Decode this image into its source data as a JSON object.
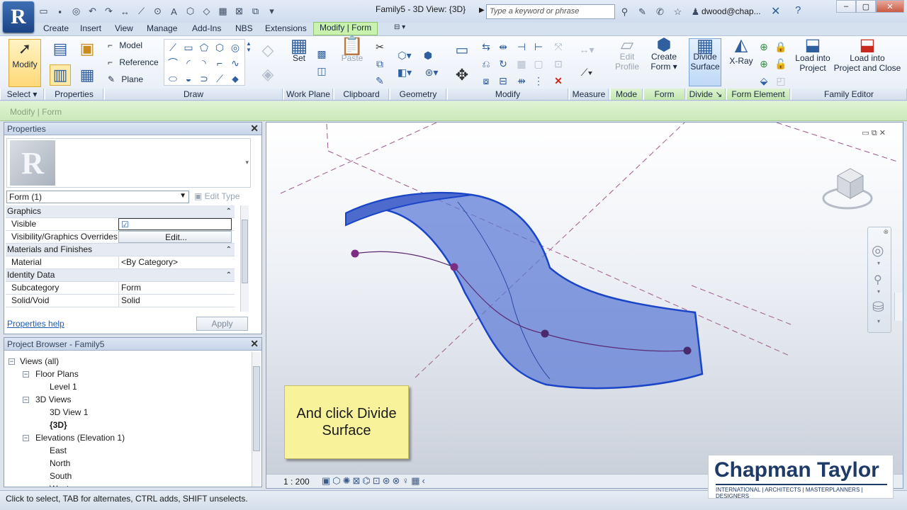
{
  "title_bar": {
    "window_title": "Family5 - 3D View: {3D}",
    "search_placeholder": "Type a keyword or phrase",
    "user": "dwood@chap...",
    "app_logo": "R"
  },
  "tabs": [
    "Create",
    "Insert",
    "View",
    "Manage",
    "Add-Ins",
    "NBS",
    "Extensions",
    "Modify | Form"
  ],
  "active_tab": "Modify | Form",
  "ribbon": {
    "select_big": "Modify",
    "draw_items": [
      "Model",
      "Reference",
      "Plane"
    ],
    "workplane_set": "Set",
    "paste": "Paste",
    "mode_btn": [
      "Edit",
      "Profile"
    ],
    "form_btn": [
      "Create",
      "Form"
    ],
    "divide_btn": [
      "Divide",
      "Surface"
    ],
    "xray": "X-Ray",
    "load_project": [
      "Load into",
      "Project"
    ],
    "load_close": [
      "Load into",
      "Project and Close"
    ],
    "panels": {
      "select": "Select",
      "properties": "Properties",
      "draw": "Draw",
      "workplane": "Work Plane",
      "clipboard": "Clipboard",
      "geometry": "Geometry",
      "modify": "Modify",
      "measure": "Measure",
      "mode": "Mode",
      "form": "Form",
      "divide": "Divide",
      "form_element": "Form Element",
      "family_editor": "Family Editor"
    }
  },
  "options_bar": "Modify | Form",
  "properties_panel": {
    "title": "Properties",
    "type_selector": "Form (1)",
    "edit_type": "Edit Type",
    "rows": [
      {
        "cat": "Graphics"
      },
      {
        "k": "Visible",
        "v": "☑"
      },
      {
        "k": "Visibility/Graphics Overrides",
        "v": "Edit..."
      },
      {
        "cat": "Materials and Finishes"
      },
      {
        "k": "Material",
        "v": "<By Category>"
      },
      {
        "cat": "Identity Data"
      },
      {
        "k": "Subcategory",
        "v": "Form"
      },
      {
        "k": "Solid/Void",
        "v": "Solid"
      }
    ],
    "help_link": "Properties help",
    "apply": "Apply"
  },
  "project_browser": {
    "title": "Project Browser - Family5",
    "nodes": [
      {
        "label": "Views (all)",
        "level": 0,
        "toggle": "−"
      },
      {
        "label": "Floor Plans",
        "level": 1,
        "toggle": "−"
      },
      {
        "label": "Level 1",
        "level": 2
      },
      {
        "label": "3D Views",
        "level": 1,
        "toggle": "−"
      },
      {
        "label": "3D View 1",
        "level": 2
      },
      {
        "label": "{3D}",
        "level": 2,
        "bold": true
      },
      {
        "label": "Elevations (Elevation 1)",
        "level": 1,
        "toggle": "−"
      },
      {
        "label": "East",
        "level": 2
      },
      {
        "label": "North",
        "level": 2
      },
      {
        "label": "South",
        "level": 2
      },
      {
        "label": "West",
        "level": 2
      }
    ]
  },
  "viewport": {
    "scale": "1 : 200",
    "callout": "And click Divide Surface",
    "surface_color": "#5a78d6"
  },
  "status_bar": "Click to select, TAB for alternates, CTRL adds, SHIFT unselects.",
  "logo": {
    "name": "Chapman Taylor",
    "tagline": "INTERNATIONAL | ARCHITECTS | MASTERPLANNERS | DESIGNERS"
  }
}
